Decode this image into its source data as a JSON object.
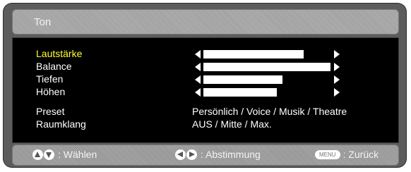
{
  "menu": {
    "title": "Ton",
    "sliders": [
      {
        "label": "Lautstärke",
        "value": 0.79,
        "selected": true
      },
      {
        "label": "Balance",
        "value": 1.0,
        "selected": false
      },
      {
        "label": "Tiefen",
        "value": 0.62,
        "selected": false
      },
      {
        "label": "Höhen",
        "value": 0.58,
        "selected": false
      }
    ],
    "options": [
      {
        "label": "Preset",
        "value": "Persönlich / Voice / Musik / Theatre"
      },
      {
        "label": "Raumklang",
        "value": "AUS / Mitte / Max."
      }
    ]
  },
  "footer": {
    "select_label": ": Wählen",
    "adjust_label": ": Abstimmung",
    "menu_button": "MENU",
    "back_label": ": Zurück"
  },
  "colors": {
    "selected": "#ffff33",
    "text": "#ffffff",
    "panel": "#000000",
    "frame": "#5c5c5c"
  },
  "icons": {
    "select": "up-down-arrows-icon",
    "adjust": "left-right-arrows-icon",
    "back": "menu-button-icon"
  }
}
